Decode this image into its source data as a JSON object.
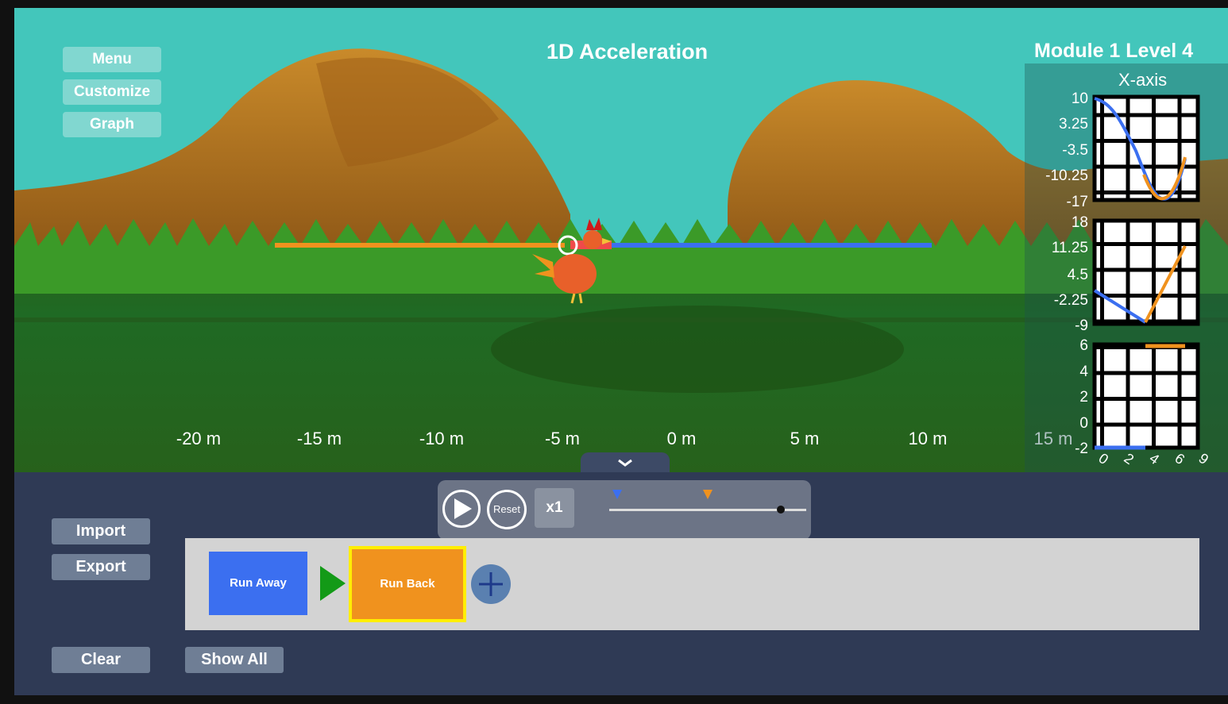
{
  "title": "1D Acceleration",
  "level": "Module 1 Level 4",
  "top_menu": {
    "menu": "Menu",
    "customize": "Customize",
    "graph": "Graph"
  },
  "position_axis": [
    "-20 m",
    "-15 m",
    "-10 m",
    "-5 m",
    "0 m",
    "5 m",
    "10 m",
    "15 m"
  ],
  "graph_panel": {
    "title": "X-axis",
    "position_ticks": [
      "10",
      "3.25",
      "-3.5",
      "-10.25",
      "-17"
    ],
    "velocity_ticks": [
      "18",
      "11.25",
      "4.5",
      "-2.25",
      "-9"
    ],
    "acceleration_ticks": [
      "6",
      "4",
      "2",
      "0",
      "-2"
    ],
    "time_ticks": [
      "0",
      "2",
      "4",
      "6",
      "9"
    ]
  },
  "playbar": {
    "play_icon": "play-icon",
    "reset": "Reset",
    "speed": "x1"
  },
  "side_buttons": {
    "import": "Import",
    "export": "Export",
    "clear": "Clear",
    "show_all": "Show All"
  },
  "timeline": {
    "blocks": [
      {
        "label": "Run Away",
        "color": "#3b6ff0"
      },
      {
        "label": "Run Back",
        "color": "#f0921e"
      }
    ],
    "arrow_icon": "play-arrow-icon",
    "add_icon": "plus-icon"
  },
  "colors": {
    "sky": "#43c6bb",
    "hill": "#b56f1e",
    "grass": "#2f7a1f",
    "run_away": "#3b6ff0",
    "run_back": "#f0921e",
    "selected_border": "#ffee00"
  }
}
